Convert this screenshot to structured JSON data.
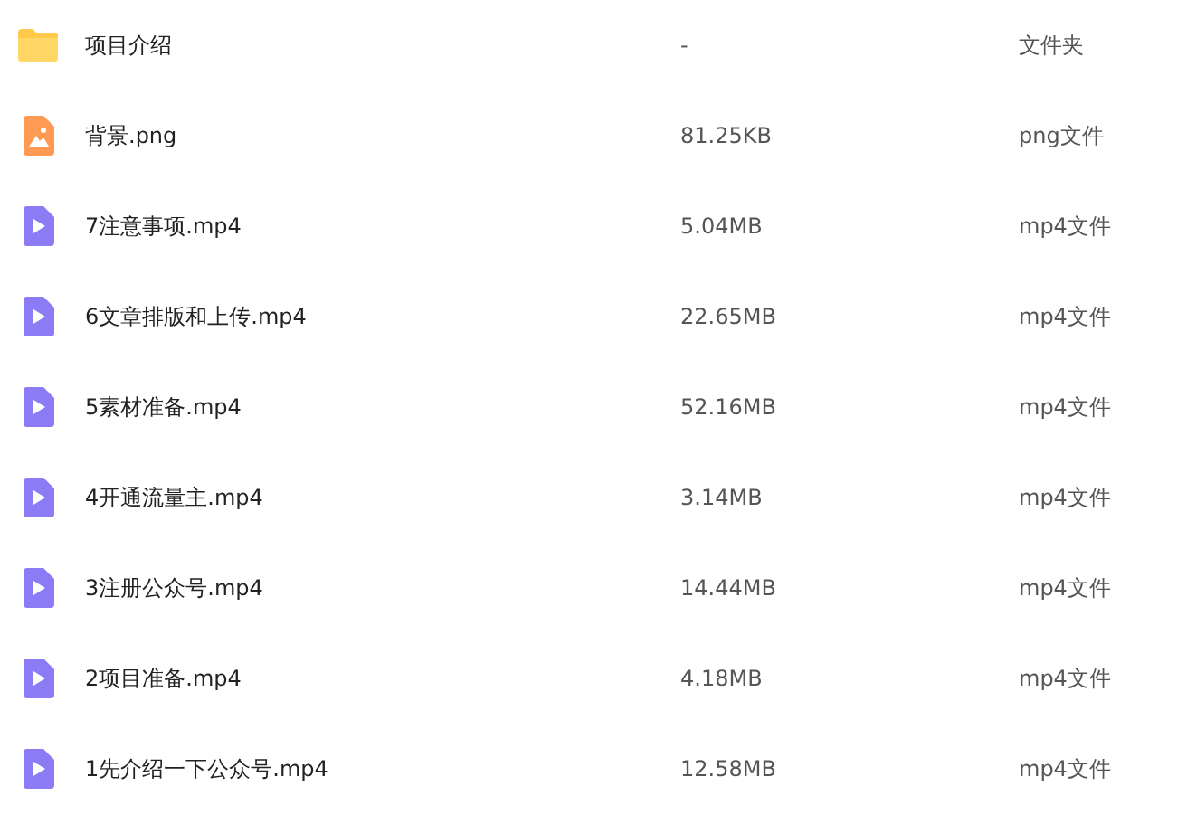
{
  "files": [
    {
      "kind": "folder",
      "name": "项目介绍",
      "size": "-",
      "type": "文件夹"
    },
    {
      "kind": "image",
      "name": "背景.png",
      "size": "81.25KB",
      "type": "png文件"
    },
    {
      "kind": "video",
      "name": "7注意事项.mp4",
      "size": "5.04MB",
      "type": "mp4文件"
    },
    {
      "kind": "video",
      "name": "6文章排版和上传.mp4",
      "size": "22.65MB",
      "type": "mp4文件"
    },
    {
      "kind": "video",
      "name": "5素材准备.mp4",
      "size": "52.16MB",
      "type": "mp4文件"
    },
    {
      "kind": "video",
      "name": "4开通流量主.mp4",
      "size": "3.14MB",
      "type": "mp4文件"
    },
    {
      "kind": "video",
      "name": "3注册公众号.mp4",
      "size": "14.44MB",
      "type": "mp4文件"
    },
    {
      "kind": "video",
      "name": "2项目准备.mp4",
      "size": "4.18MB",
      "type": "mp4文件"
    },
    {
      "kind": "video",
      "name": "1先介绍一下公众号.mp4",
      "size": "12.58MB",
      "type": "mp4文件"
    }
  ]
}
